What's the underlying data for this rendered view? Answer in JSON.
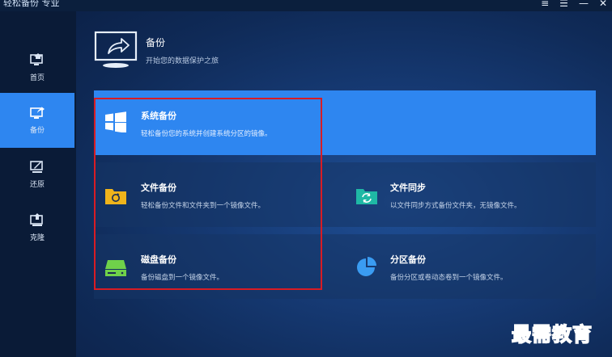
{
  "window": {
    "title": "轻松备份 专业",
    "controls": [
      "≡",
      "☰",
      "—",
      "✕"
    ]
  },
  "sidebar": {
    "items": [
      {
        "label": "首页",
        "icon": "home-monitor-icon"
      },
      {
        "label": "备份",
        "icon": "backup-monitor-icon",
        "active": true
      },
      {
        "label": "还原",
        "icon": "restore-monitor-icon"
      },
      {
        "label": "克隆",
        "icon": "clone-monitor-icon"
      }
    ]
  },
  "header": {
    "title": "备份",
    "subtitle": "开始您的数据保护之旅",
    "icon": "monitor-share-icon"
  },
  "options": {
    "system": {
      "title": "系统备份",
      "desc": "轻松备份您的系统并创建系统分区的镜像。",
      "icon": "windows-icon"
    },
    "file": {
      "title": "文件备份",
      "desc": "轻松备份文件和文件夹到一个镜像文件。",
      "icon": "folder-refresh-icon"
    },
    "sync": {
      "title": "文件同步",
      "desc": "以文件同步方式备份文件夹，无镜像文件。",
      "icon": "folder-sync-icon"
    },
    "disk": {
      "title": "磁盘备份",
      "desc": "备份磁盘到一个镜像文件。",
      "icon": "disk-drive-icon"
    },
    "partition": {
      "title": "分区备份",
      "desc": "备份分区或卷动态卷到一个镜像文件。",
      "icon": "pie-chart-icon"
    }
  },
  "colors": {
    "accent": "#2e86f0",
    "highlight_border": "#d81c24"
  },
  "watermark": "最需教育"
}
